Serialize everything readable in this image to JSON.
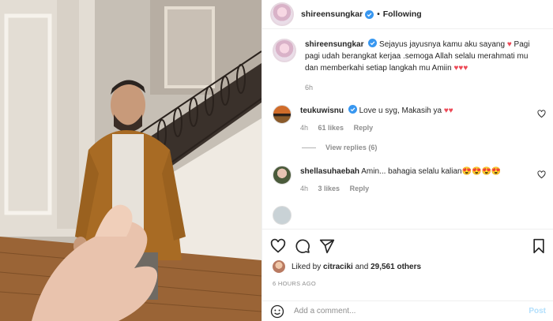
{
  "header": {
    "username": "shireensungkar",
    "separator": "•",
    "follow_label": "Following"
  },
  "caption": {
    "username": "shireensungkar",
    "text": "Sejayus jayusnya kamu aku sayang ♥ Pagi pagi udah berangkat kerjaa .semoga Allah selalu merahmati mu dan memberkahi setiap langkah mu Amiin ♥♥♥",
    "time": "6h"
  },
  "comments": [
    {
      "username": "teukuwisnu",
      "text": "Love u syg, Makasih ya ♥♥",
      "time": "4h",
      "likes": "61 likes",
      "reply": "Reply",
      "view_replies": "View replies (6)"
    },
    {
      "username": "shellasuhaebah",
      "text": "Amin... bahagia selalu kalian😍😍😍😍",
      "time": "4h",
      "likes": "3 likes",
      "reply": "Reply"
    }
  ],
  "likes": {
    "prefix": "Liked by",
    "user": "citraciki",
    "connector": "and",
    "count": "29,561 others"
  },
  "timestamp": "6 HOURS AGO",
  "add_comment": {
    "placeholder": "Add a comment...",
    "post_label": "Post"
  },
  "colors": {
    "verified": "#3897f0",
    "heart": "#ed4956",
    "post_disabled": "#b2dffc"
  },
  "icons": [
    "heart-icon",
    "comment-icon",
    "share-icon",
    "bookmark-icon",
    "smile-icon",
    "verified-icon"
  ]
}
